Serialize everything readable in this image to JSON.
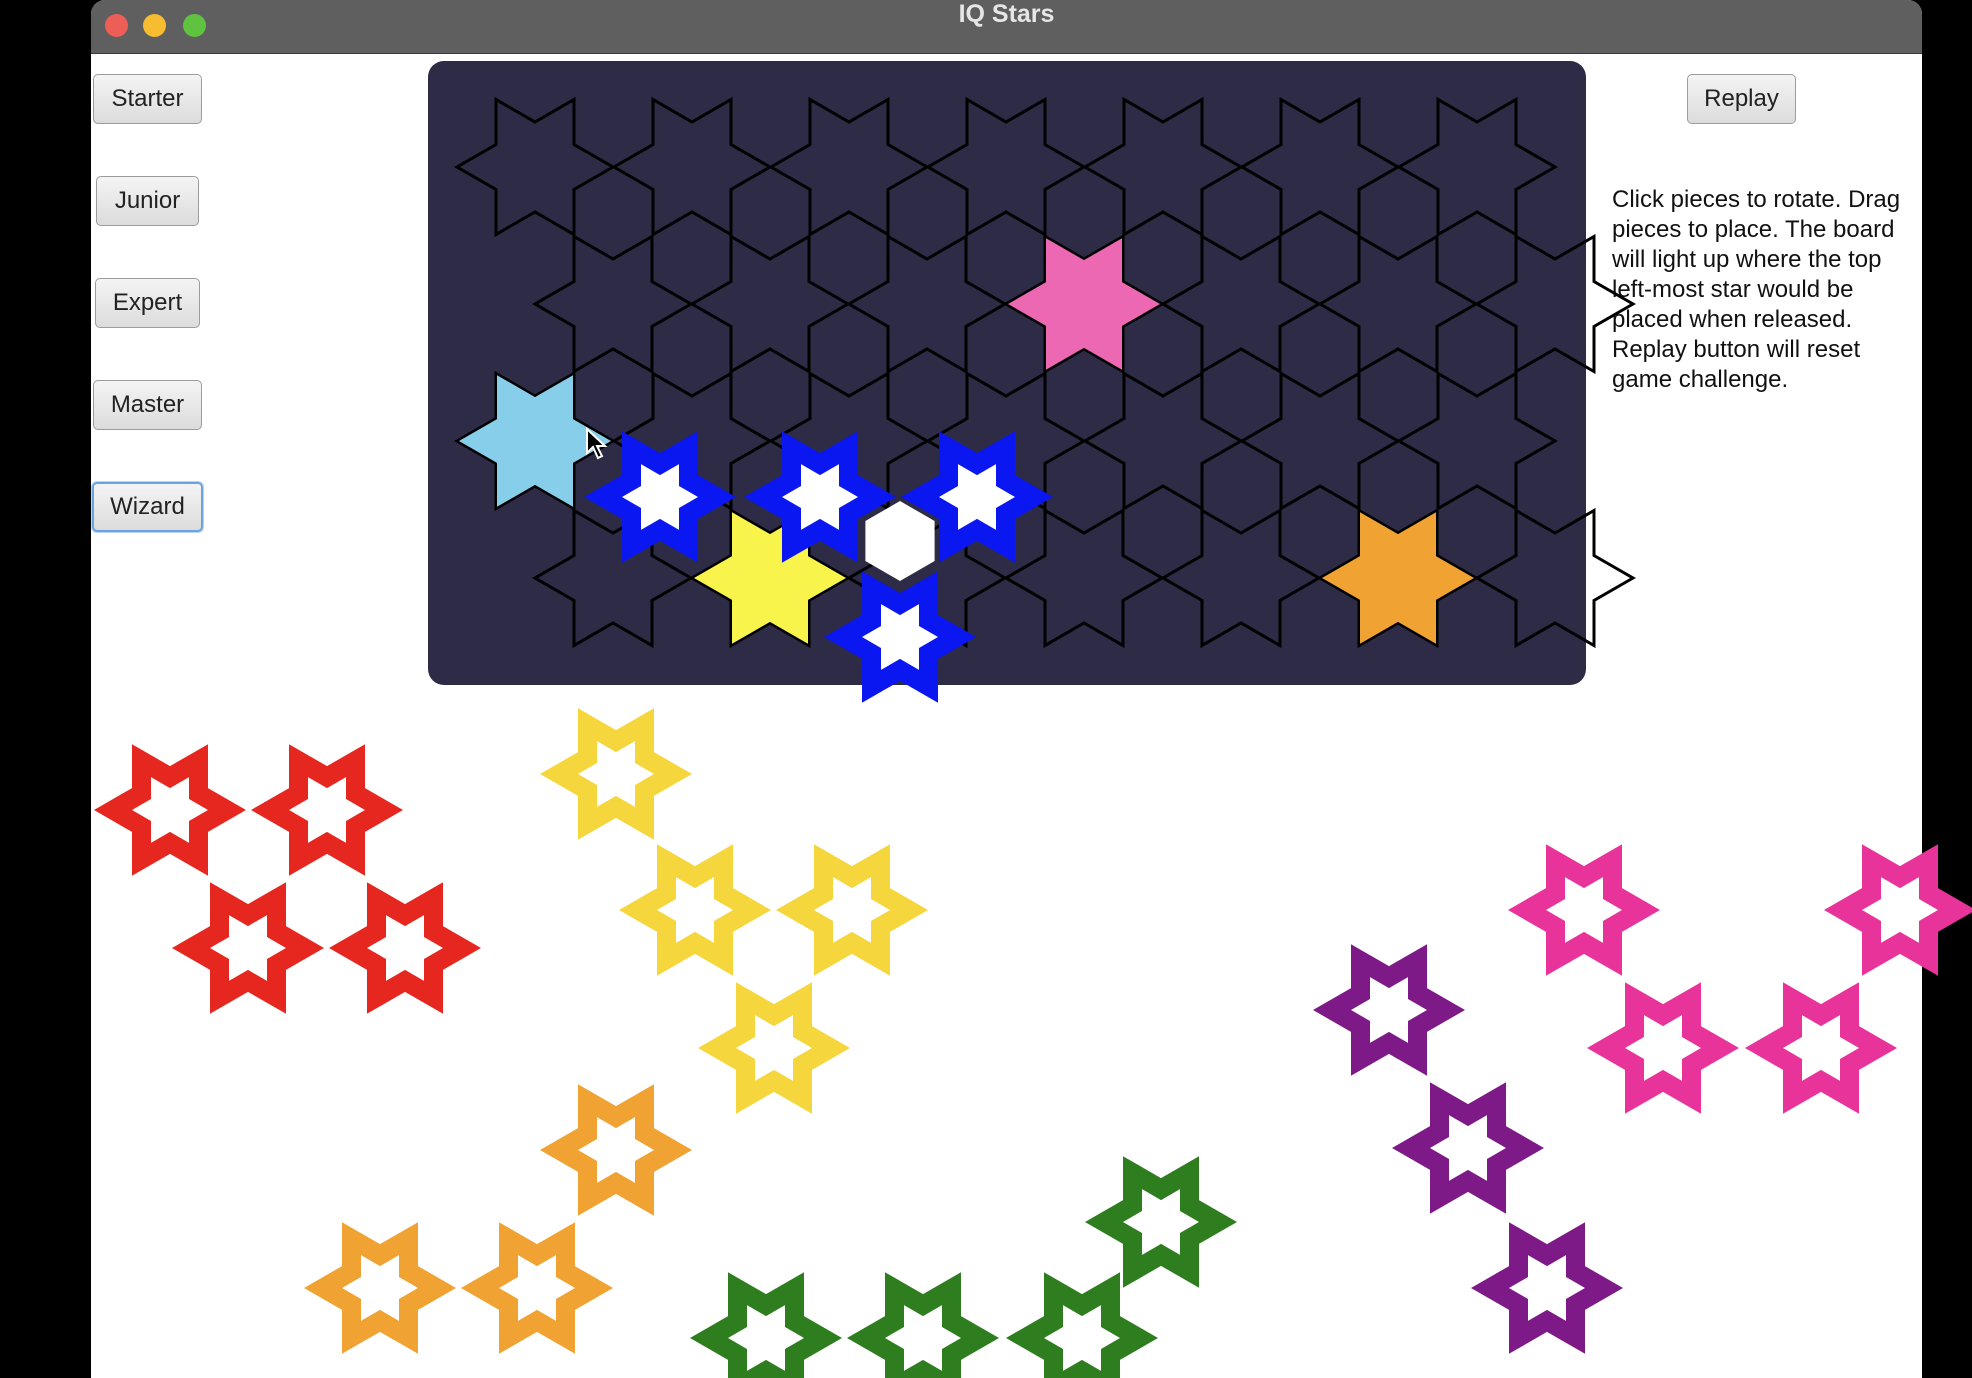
{
  "window": {
    "title": "IQ Stars",
    "traffic_lights": {
      "close": "#ed5e56",
      "minimize": "#f5bd2f",
      "zoom": "#5fc33f"
    }
  },
  "levels": [
    {
      "label": "Starter"
    },
    {
      "label": "Junior"
    },
    {
      "label": "Expert"
    },
    {
      "label": "Master"
    },
    {
      "label": "Wizard",
      "focused": true
    }
  ],
  "replay_label": "Replay",
  "instructions": "Click pieces to rotate. Drag pieces to place. The board will light up where the top left-most star would be placed when released. Replay button will reset game challenge.",
  "colors": {
    "board": "#2d2b45",
    "grid_line": "#000000",
    "red": "#e5271f",
    "yellow": "#f6d63d",
    "orange": "#f0a232",
    "green": "#2e7d1f",
    "purple": "#7e1a87",
    "pink": "#e8339a",
    "blue": "#0a17f0",
    "light_blue": "#87ceeb",
    "board_pink": "#ec68b2",
    "board_yellow": "#f9f44b"
  },
  "board": {
    "rows": 4,
    "cols": 7,
    "filled_cells": [
      {
        "row": 1,
        "col": 3,
        "color": "board_pink"
      },
      {
        "row": 2,
        "col": 0,
        "color": "light_blue"
      },
      {
        "row": 3,
        "col": 1,
        "color": "board_yellow"
      },
      {
        "row": 3,
        "col": 5,
        "color": "orange"
      }
    ]
  },
  "pieces": [
    {
      "name": "blue-piece",
      "color": "blue",
      "cells": 4
    },
    {
      "name": "red-piece",
      "color": "red",
      "cells": 4
    },
    {
      "name": "yellow-piece",
      "color": "yellow",
      "cells": 4
    },
    {
      "name": "orange-piece",
      "color": "orange",
      "cells": 3
    },
    {
      "name": "green-piece",
      "color": "green",
      "cells": 4
    },
    {
      "name": "purple-piece",
      "color": "purple",
      "cells": 3
    },
    {
      "name": "pink-piece",
      "color": "pink",
      "cells": 4
    }
  ]
}
